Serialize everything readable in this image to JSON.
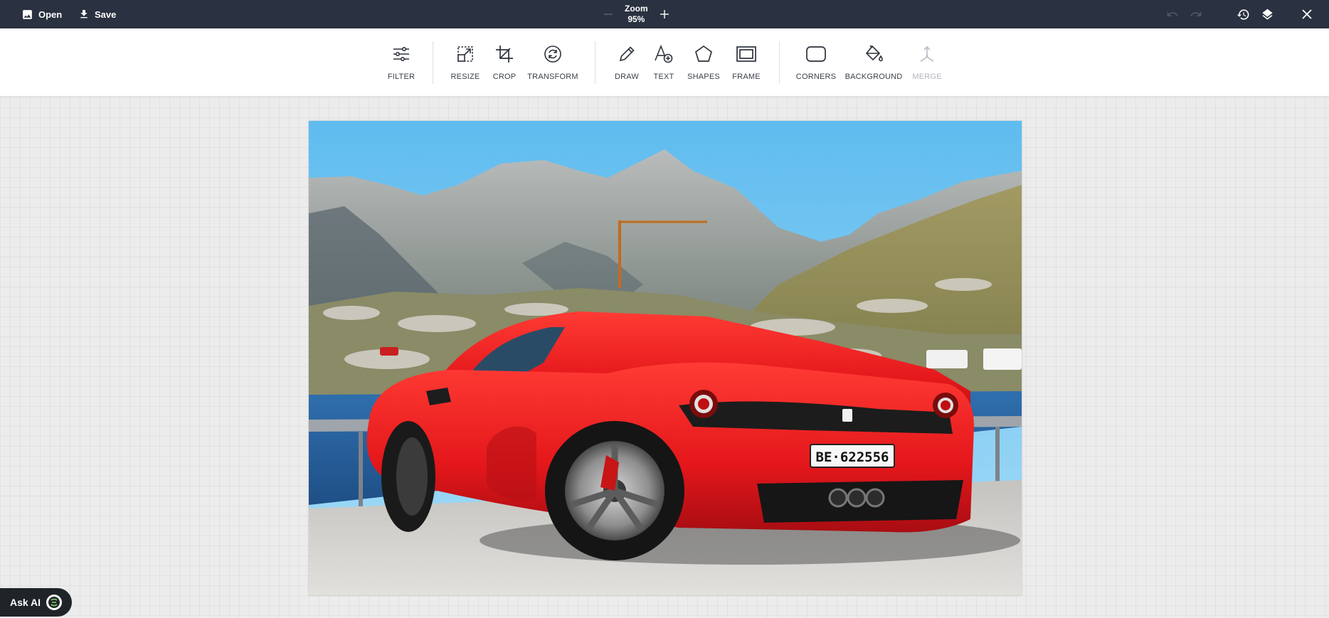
{
  "topbar": {
    "open_label": "Open",
    "save_label": "Save",
    "zoom_title": "Zoom",
    "zoom_value": "95%",
    "icons": [
      "image-icon",
      "download-icon",
      "minus-icon",
      "plus-icon",
      "undo-icon",
      "redo-icon",
      "history-icon",
      "layers-icon",
      "close-icon"
    ]
  },
  "tools": [
    {
      "id": "filter",
      "label": "FILTER",
      "icon": "filter-icon"
    },
    {
      "id": "resize",
      "label": "RESIZE",
      "icon": "resize-icon"
    },
    {
      "id": "crop",
      "label": "CROP",
      "icon": "crop-icon"
    },
    {
      "id": "transform",
      "label": "TRANSFORM",
      "icon": "transform-icon"
    },
    {
      "id": "draw",
      "label": "DRAW",
      "icon": "pencil-icon"
    },
    {
      "id": "text",
      "label": "TEXT",
      "icon": "text-icon"
    },
    {
      "id": "shapes",
      "label": "SHAPES",
      "icon": "shapes-icon"
    },
    {
      "id": "frame",
      "label": "FRAME",
      "icon": "frame-icon"
    },
    {
      "id": "corners",
      "label": "CORNERS",
      "icon": "corners-icon"
    },
    {
      "id": "background",
      "label": "BACKGROUND",
      "icon": "paint-bucket-icon"
    },
    {
      "id": "merge",
      "label": "MERGE",
      "icon": "merge-icon",
      "disabled": true
    }
  ],
  "photo": {
    "plate_text": "BE·622556"
  },
  "ask_ai": {
    "label": "Ask AI"
  },
  "colors": {
    "topbar": "#2a3140",
    "car_red": "#e41a1c",
    "sky": "#6cc6f2"
  }
}
